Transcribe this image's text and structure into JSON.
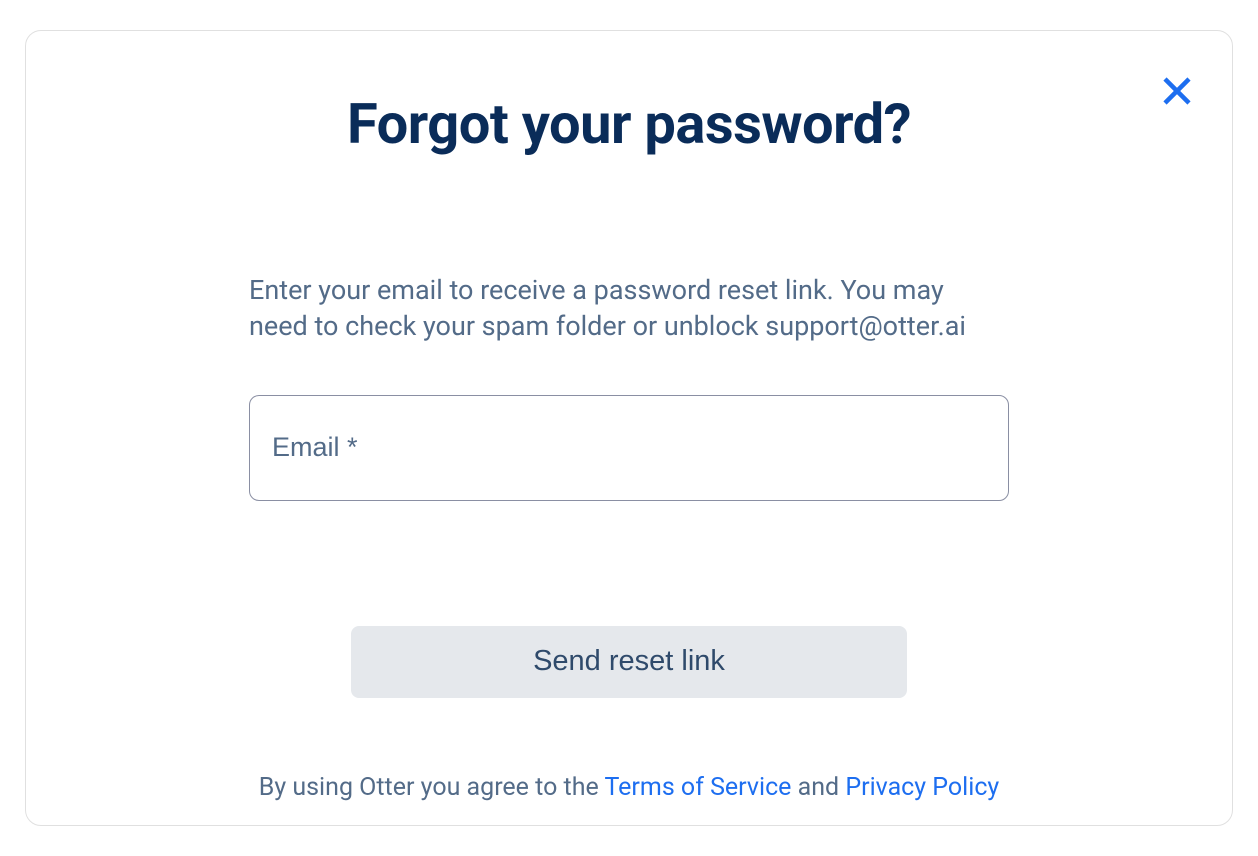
{
  "dialog": {
    "title": "Forgot your password?",
    "description": "Enter your email to receive a password reset link. You may need to check your spam folder or unblock support@otter.ai",
    "email_placeholder": "Email *",
    "email_value": "",
    "submit_label": "Send reset link",
    "footer_prefix": "By using Otter you agree to the ",
    "terms_label": "Terms of Service",
    "footer_middle": " and ",
    "privacy_label": "Privacy Policy"
  }
}
